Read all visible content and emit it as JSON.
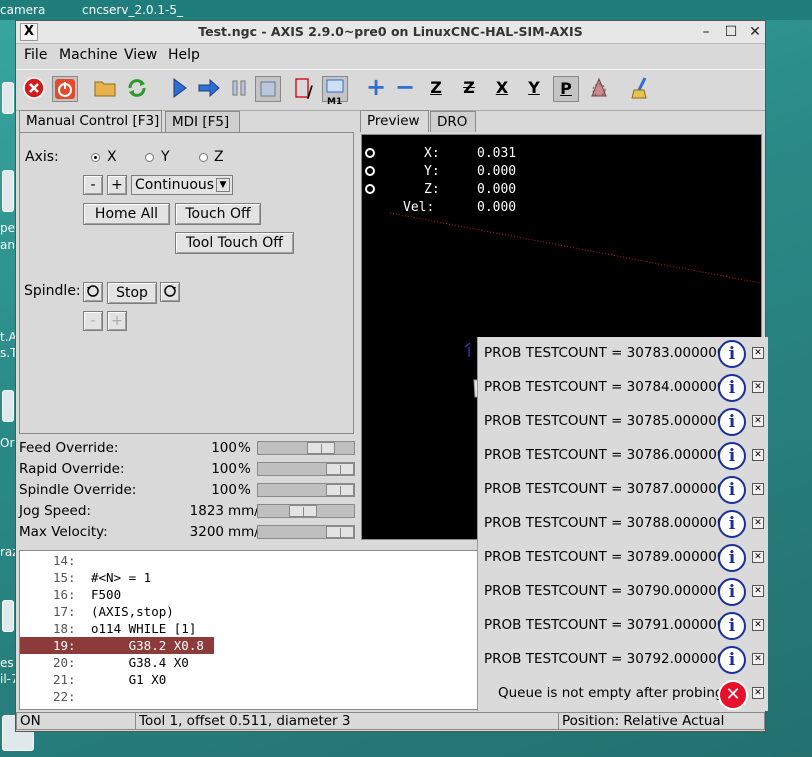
{
  "desktop": {
    "labels": [
      "camera",
      "cncserv_2.0.1-5_"
    ],
    "side_labels": [
      "pe_",
      "an",
      "t.A",
      "s.T",
      "Or",
      "raz",
      "es",
      "il-7"
    ]
  },
  "window": {
    "title": "Test.ngc - AXIS 2.9.0~pre0 on LinuxCNC-HAL-SIM-AXIS",
    "app_icon": "X",
    "minimize": "–",
    "maximize": "☐",
    "close": "✕"
  },
  "menu": [
    {
      "label": "File"
    },
    {
      "label": "Machine"
    },
    {
      "label": "View"
    },
    {
      "label": "Help"
    }
  ],
  "toolbar": {
    "icons": [
      "estop-icon",
      "power-icon",
      "open-file-icon",
      "reload-icon",
      "run-icon",
      "step-icon",
      "pause-icon",
      "stop-icon",
      "block-delete-icon",
      "optional-stop-icon",
      "zoom-in-icon",
      "zoom-out-icon",
      "view-z-icon",
      "view-z2-icon",
      "view-x-icon",
      "view-y-icon",
      "view-p-icon",
      "rotate-view-icon",
      "clear-plot-icon"
    ],
    "block_delete_label": "/",
    "optional_stop_label": "M1",
    "view_labels": [
      "Z",
      "Z",
      "X",
      "Y",
      "P"
    ]
  },
  "left_tabs": [
    {
      "label": "Manual Control [F3]",
      "active": true
    },
    {
      "label": "MDI [F5]",
      "active": false
    }
  ],
  "manual": {
    "axis_label": "Axis:",
    "axes": [
      {
        "label": "X",
        "selected": true
      },
      {
        "label": "Y",
        "selected": false
      },
      {
        "label": "Z",
        "selected": false
      }
    ],
    "jog_minus": "-",
    "jog_plus": "+",
    "jog_mode": "Continuous",
    "home_all": "Home All",
    "touch_off": "Touch Off",
    "tool_touch_off": "Tool Touch Off",
    "spindle_label": "Spindle:",
    "spindle_stop": "Stop",
    "spindle_minus": "-",
    "spindle_plus": "+"
  },
  "overrides": [
    {
      "name": "Feed Override:",
      "value": "100",
      "unit": "%",
      "level": 0.72
    },
    {
      "name": "Rapid Override:",
      "value": "100",
      "unit": "%",
      "level": 1.0
    },
    {
      "name": "Spindle Override:",
      "value": "100",
      "unit": "%",
      "level": 1.0
    },
    {
      "name": "Jog Speed:",
      "value": "1823",
      "unit": "mm/min",
      "level": 0.45
    },
    {
      "name": "Max Velocity:",
      "value": "3200",
      "unit": "mm/min",
      "level": 1.0
    }
  ],
  "right_tabs": [
    {
      "label": "Preview",
      "active": true
    },
    {
      "label": "DRO",
      "active": false
    }
  ],
  "dro": [
    {
      "axis": "X:",
      "value": "0.031"
    },
    {
      "axis": "Y:",
      "value": "0.000"
    },
    {
      "axis": "Z:",
      "value": "0.000"
    },
    {
      "axis": "Vel:",
      "value": "0.000"
    }
  ],
  "gcode": [
    {
      "line": "14:",
      "text": "",
      "highlight": false
    },
    {
      "line": "15:",
      "text": "#<N> = 1",
      "highlight": false
    },
    {
      "line": "16:",
      "text": "F500",
      "highlight": false
    },
    {
      "line": "17:",
      "text": "(AXIS,stop)",
      "highlight": false
    },
    {
      "line": "18:",
      "text": "o114 WHILE [1]",
      "highlight": false
    },
    {
      "line": "19:",
      "text": "     G38.2 X0.8",
      "highlight": true
    },
    {
      "line": "20:",
      "text": "     G38.4 X0",
      "highlight": false
    },
    {
      "line": "21:",
      "text": "     G1 X0",
      "highlight": false
    },
    {
      "line": "22:",
      "text": "",
      "highlight": false
    }
  ],
  "status": {
    "machine": "ON",
    "tool": "Tool 1, offset 0.511, diameter 3",
    "position": "Position: Relative Actual"
  },
  "notifications": [
    {
      "text": "PROB TESTCOUNT = 30783.000000",
      "kind": "info"
    },
    {
      "text": "PROB TESTCOUNT = 30784.000000",
      "kind": "info"
    },
    {
      "text": "PROB TESTCOUNT = 30785.000000",
      "kind": "info"
    },
    {
      "text": "PROB TESTCOUNT = 30786.000000",
      "kind": "info"
    },
    {
      "text": "PROB TESTCOUNT = 30787.000000",
      "kind": "info"
    },
    {
      "text": "PROB TESTCOUNT = 30788.000000",
      "kind": "info"
    },
    {
      "text": "PROB TESTCOUNT = 30789.000000",
      "kind": "info"
    },
    {
      "text": "PROB TESTCOUNT = 30790.000000",
      "kind": "info"
    },
    {
      "text": "PROB TESTCOUNT = 30791.000000",
      "kind": "info"
    },
    {
      "text": "PROB TESTCOUNT = 30792.000000",
      "kind": "info"
    },
    {
      "text": "Queue is not empty after probing",
      "kind": "error"
    }
  ],
  "notification_icons": {
    "info": "i",
    "error": "✕",
    "close": "✕"
  },
  "colors": {
    "highlight_line": "#8d3a3a",
    "info_icon": "#1a2f9e",
    "error_icon": "#e8102a",
    "estop": "#d21b1b"
  }
}
